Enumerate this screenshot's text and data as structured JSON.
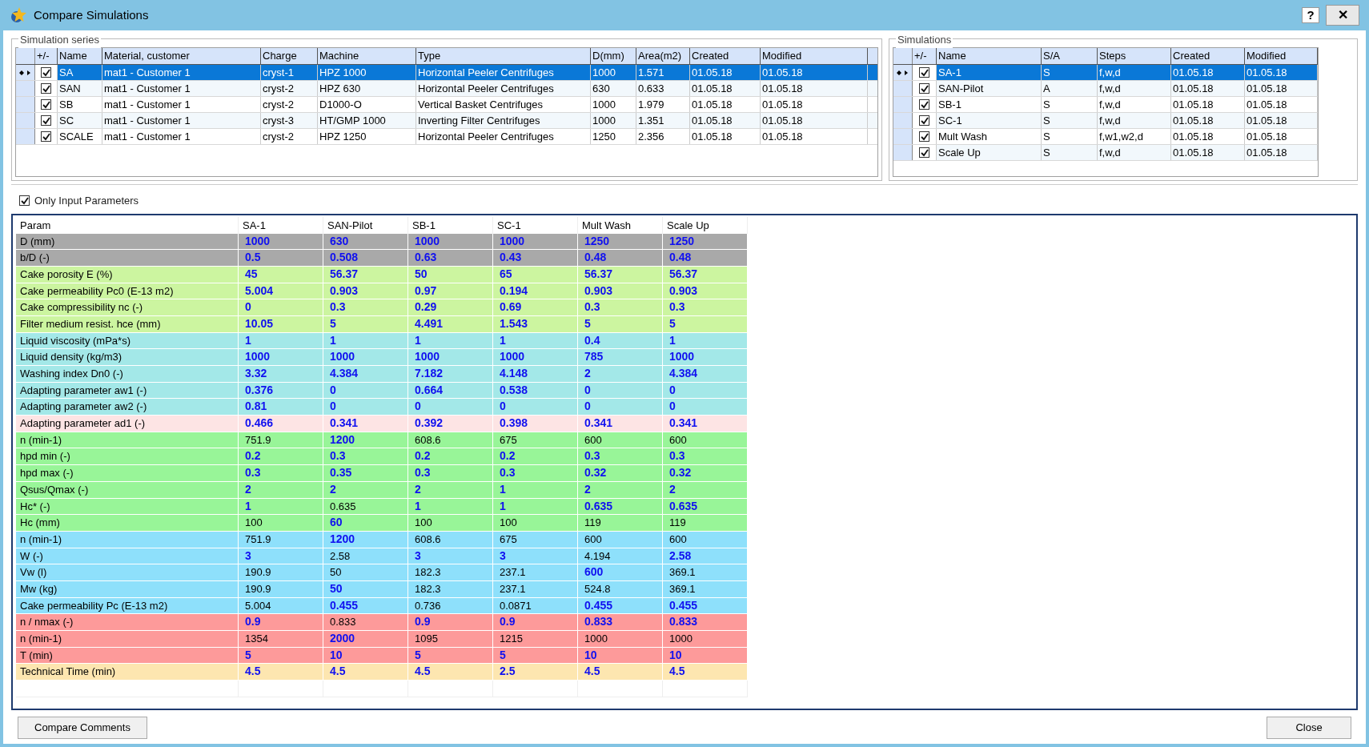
{
  "window": {
    "title": "Compare Simulations",
    "help": "?",
    "close": "✕"
  },
  "simulation_series": {
    "title": "Simulation series",
    "check_column": "+/-",
    "columns": [
      "Name",
      "Material, customer",
      "Charge",
      "Machine",
      "Type",
      "D(mm)",
      "Area(m2)",
      "Created",
      "Modified"
    ],
    "rows": [
      {
        "selected": true,
        "checked": true,
        "cells": [
          "SA",
          "mat1 - Customer 1",
          "cryst-1",
          "HPZ 1000",
          "Horizontal Peeler Centrifuges",
          "1000",
          "1.571",
          "01.05.18",
          "01.05.18"
        ]
      },
      {
        "selected": false,
        "checked": true,
        "cells": [
          "SAN",
          "mat1 - Customer 1",
          "cryst-2",
          "HPZ 630",
          "Horizontal Peeler Centrifuges",
          "630",
          "0.633",
          "01.05.18",
          "01.05.18"
        ]
      },
      {
        "selected": false,
        "checked": true,
        "cells": [
          "SB",
          "mat1 - Customer 1",
          "cryst-2",
          "D1000-O",
          "Vertical Basket Centrifuges",
          "1000",
          "1.979",
          "01.05.18",
          "01.05.18"
        ]
      },
      {
        "selected": false,
        "checked": true,
        "cells": [
          "SC",
          "mat1 - Customer 1",
          "cryst-3",
          "HT/GMP 1000",
          "Inverting Filter Centrifuges",
          "1000",
          "1.351",
          "01.05.18",
          "01.05.18"
        ]
      },
      {
        "selected": false,
        "checked": true,
        "cells": [
          "SCALE",
          "mat1 - Customer 1",
          "cryst-2",
          "HPZ 1250",
          "Horizontal Peeler Centrifuges",
          "1250",
          "2.356",
          "01.05.18",
          "01.05.18"
        ]
      }
    ]
  },
  "simulations": {
    "title": "Simulations",
    "check_column": "+/-",
    "columns": [
      "Name",
      "S/A",
      "Steps",
      "Created",
      "Modified"
    ],
    "rows": [
      {
        "selected": true,
        "checked": true,
        "cells": [
          "SA-1",
          "S",
          "f,w,d",
          "01.05.18",
          "01.05.18"
        ]
      },
      {
        "selected": false,
        "checked": true,
        "cells": [
          "SAN-Pilot",
          "A",
          "f,w,d",
          "01.05.18",
          "01.05.18"
        ]
      },
      {
        "selected": false,
        "checked": true,
        "cells": [
          "SB-1",
          "S",
          "f,w,d",
          "01.05.18",
          "01.05.18"
        ]
      },
      {
        "selected": false,
        "checked": true,
        "cells": [
          "SC-1",
          "S",
          "f,w,d",
          "01.05.18",
          "01.05.18"
        ]
      },
      {
        "selected": false,
        "checked": true,
        "cells": [
          "Mult Wash",
          "S",
          "f,w1,w2,d",
          "01.05.18",
          "01.05.18"
        ]
      },
      {
        "selected": false,
        "checked": true,
        "cells": [
          "Scale Up",
          "S",
          "f,w,d",
          "01.05.18",
          "01.05.18"
        ]
      }
    ]
  },
  "only_input_parameters": {
    "label": "Only Input Parameters",
    "checked": true
  },
  "comparison": {
    "columns": [
      "Param",
      "SA-1",
      "SAN-Pilot",
      "SB-1",
      "SC-1",
      "Mult Wash",
      "Scale Up"
    ],
    "rows": [
      {
        "param": "D (mm)",
        "color": "#a9a9a9",
        "values": [
          {
            "text": "1000",
            "bold": true
          },
          {
            "text": "630",
            "bold": true
          },
          {
            "text": "1000",
            "bold": true
          },
          {
            "text": "1000",
            "bold": true
          },
          {
            "text": "1250",
            "bold": true
          },
          {
            "text": "1250",
            "bold": true
          }
        ]
      },
      {
        "param": "b/D (-)",
        "color": "#a9a9a9",
        "values": [
          {
            "text": "0.5",
            "bold": true
          },
          {
            "text": "0.508",
            "bold": true
          },
          {
            "text": "0.63",
            "bold": true
          },
          {
            "text": "0.43",
            "bold": true
          },
          {
            "text": "0.48",
            "bold": true
          },
          {
            "text": "0.48",
            "bold": true
          }
        ]
      },
      {
        "param": "Cake porosity E (%)",
        "color": "#ccf5a0",
        "values": [
          {
            "text": "45",
            "bold": true
          },
          {
            "text": "56.37",
            "bold": true
          },
          {
            "text": "50",
            "bold": true
          },
          {
            "text": "65",
            "bold": true
          },
          {
            "text": "56.37",
            "bold": true
          },
          {
            "text": "56.37",
            "bold": true
          }
        ]
      },
      {
        "param": "Cake permeability Pc0 (E-13 m2)",
        "color": "#ccf5a0",
        "values": [
          {
            "text": "5.004",
            "bold": true
          },
          {
            "text": "0.903",
            "bold": true
          },
          {
            "text": "0.97",
            "bold": true
          },
          {
            "text": "0.194",
            "bold": true
          },
          {
            "text": "0.903",
            "bold": true
          },
          {
            "text": "0.903",
            "bold": true
          }
        ]
      },
      {
        "param": "Cake compressibility nc (-)",
        "color": "#ccf5a0",
        "values": [
          {
            "text": "0",
            "bold": true
          },
          {
            "text": "0.3",
            "bold": true
          },
          {
            "text": "0.29",
            "bold": true
          },
          {
            "text": "0.69",
            "bold": true
          },
          {
            "text": "0.3",
            "bold": true
          },
          {
            "text": "0.3",
            "bold": true
          }
        ]
      },
      {
        "param": "Filter medium resist. hce (mm)",
        "color": "#ccf5a0",
        "values": [
          {
            "text": "10.05",
            "bold": true
          },
          {
            "text": "5",
            "bold": true
          },
          {
            "text": "4.491",
            "bold": true
          },
          {
            "text": "1.543",
            "bold": true
          },
          {
            "text": "5",
            "bold": true
          },
          {
            "text": "5",
            "bold": true
          }
        ]
      },
      {
        "param": "Liquid viscosity (mPa*s)",
        "color": "#a3e8e8",
        "values": [
          {
            "text": "1",
            "bold": true
          },
          {
            "text": "1",
            "bold": true
          },
          {
            "text": "1",
            "bold": true
          },
          {
            "text": "1",
            "bold": true
          },
          {
            "text": "0.4",
            "bold": true
          },
          {
            "text": "1",
            "bold": true
          }
        ]
      },
      {
        "param": "Liquid density (kg/m3)",
        "color": "#a3e8e8",
        "values": [
          {
            "text": "1000",
            "bold": true
          },
          {
            "text": "1000",
            "bold": true
          },
          {
            "text": "1000",
            "bold": true
          },
          {
            "text": "1000",
            "bold": true
          },
          {
            "text": "785",
            "bold": true
          },
          {
            "text": "1000",
            "bold": true
          }
        ]
      },
      {
        "param": "Washing index Dn0 (-)",
        "color": "#a3e8e8",
        "values": [
          {
            "text": "3.32",
            "bold": true
          },
          {
            "text": "4.384",
            "bold": true
          },
          {
            "text": "7.182",
            "bold": true
          },
          {
            "text": "4.148",
            "bold": true
          },
          {
            "text": "2",
            "bold": true
          },
          {
            "text": "4.384",
            "bold": true
          }
        ]
      },
      {
        "param": "Adapting parameter aw1 (-)",
        "color": "#a3e8e8",
        "values": [
          {
            "text": "0.376",
            "bold": true
          },
          {
            "text": "0",
            "bold": true
          },
          {
            "text": "0.664",
            "bold": true
          },
          {
            "text": "0.538",
            "bold": true
          },
          {
            "text": "0",
            "bold": true
          },
          {
            "text": "0",
            "bold": true
          }
        ]
      },
      {
        "param": "Adapting parameter aw2 (-)",
        "color": "#a3e8e8",
        "values": [
          {
            "text": "0.81",
            "bold": true
          },
          {
            "text": "0",
            "bold": true
          },
          {
            "text": "0",
            "bold": true
          },
          {
            "text": "0",
            "bold": true
          },
          {
            "text": "0",
            "bold": true
          },
          {
            "text": "0",
            "bold": true
          }
        ]
      },
      {
        "param": "Adapting parameter ad1 (-)",
        "color": "#fde4e4",
        "values": [
          {
            "text": "0.466",
            "bold": true
          },
          {
            "text": "0.341",
            "bold": true
          },
          {
            "text": "0.392",
            "bold": true
          },
          {
            "text": "0.398",
            "bold": true
          },
          {
            "text": "0.341",
            "bold": true
          },
          {
            "text": "0.341",
            "bold": true
          }
        ]
      },
      {
        "param": "n (min-1)",
        "color": "#98f598",
        "values": [
          {
            "text": "751.9",
            "bold": false
          },
          {
            "text": "1200",
            "bold": true
          },
          {
            "text": "608.6",
            "bold": false
          },
          {
            "text": "675",
            "bold": false
          },
          {
            "text": "600",
            "bold": false
          },
          {
            "text": "600",
            "bold": false
          }
        ]
      },
      {
        "param": "hpd min (-)",
        "color": "#98f598",
        "values": [
          {
            "text": "0.2",
            "bold": true
          },
          {
            "text": "0.3",
            "bold": true
          },
          {
            "text": "0.2",
            "bold": true
          },
          {
            "text": "0.2",
            "bold": true
          },
          {
            "text": "0.3",
            "bold": true
          },
          {
            "text": "0.3",
            "bold": true
          }
        ]
      },
      {
        "param": "hpd max (-)",
        "color": "#98f598",
        "values": [
          {
            "text": "0.3",
            "bold": true
          },
          {
            "text": "0.35",
            "bold": true
          },
          {
            "text": "0.3",
            "bold": true
          },
          {
            "text": "0.3",
            "bold": true
          },
          {
            "text": "0.32",
            "bold": true
          },
          {
            "text": "0.32",
            "bold": true
          }
        ]
      },
      {
        "param": "Qsus/Qmax (-)",
        "color": "#98f598",
        "values": [
          {
            "text": "2",
            "bold": true
          },
          {
            "text": "2",
            "bold": true
          },
          {
            "text": "2",
            "bold": true
          },
          {
            "text": "1",
            "bold": true
          },
          {
            "text": "2",
            "bold": true
          },
          {
            "text": "2",
            "bold": true
          }
        ]
      },
      {
        "param": "Hc* (-)",
        "color": "#98f598",
        "values": [
          {
            "text": "1",
            "bold": true
          },
          {
            "text": "0.635",
            "bold": false
          },
          {
            "text": "1",
            "bold": true
          },
          {
            "text": "1",
            "bold": true
          },
          {
            "text": "0.635",
            "bold": true
          },
          {
            "text": "0.635",
            "bold": true
          }
        ]
      },
      {
        "param": "Hc (mm)",
        "color": "#98f598",
        "values": [
          {
            "text": "100",
            "bold": false
          },
          {
            "text": "60",
            "bold": true
          },
          {
            "text": "100",
            "bold": false
          },
          {
            "text": "100",
            "bold": false
          },
          {
            "text": "119",
            "bold": false
          },
          {
            "text": "119",
            "bold": false
          }
        ]
      },
      {
        "param": "n (min-1)",
        "color": "#8ee0fb",
        "values": [
          {
            "text": "751.9",
            "bold": false
          },
          {
            "text": "1200",
            "bold": true
          },
          {
            "text": "608.6",
            "bold": false
          },
          {
            "text": "675",
            "bold": false
          },
          {
            "text": "600",
            "bold": false
          },
          {
            "text": "600",
            "bold": false
          }
        ]
      },
      {
        "param": "W (-)",
        "color": "#8ee0fb",
        "values": [
          {
            "text": "3",
            "bold": true
          },
          {
            "text": "2.58",
            "bold": false
          },
          {
            "text": "3",
            "bold": true
          },
          {
            "text": "3",
            "bold": true
          },
          {
            "text": "4.194",
            "bold": false
          },
          {
            "text": "2.58",
            "bold": true
          }
        ]
      },
      {
        "param": "Vw (l)",
        "color": "#8ee0fb",
        "values": [
          {
            "text": "190.9",
            "bold": false
          },
          {
            "text": "50",
            "bold": false
          },
          {
            "text": "182.3",
            "bold": false
          },
          {
            "text": "237.1",
            "bold": false
          },
          {
            "text": "600",
            "bold": true
          },
          {
            "text": "369.1",
            "bold": false
          }
        ]
      },
      {
        "param": "Mw (kg)",
        "color": "#8ee0fb",
        "values": [
          {
            "text": "190.9",
            "bold": false
          },
          {
            "text": "50",
            "bold": true
          },
          {
            "text": "182.3",
            "bold": false
          },
          {
            "text": "237.1",
            "bold": false
          },
          {
            "text": "524.8",
            "bold": false
          },
          {
            "text": "369.1",
            "bold": false
          }
        ]
      },
      {
        "param": "Cake permeability Pc (E-13 m2)",
        "color": "#8ee0fb",
        "values": [
          {
            "text": "5.004",
            "bold": false
          },
          {
            "text": "0.455",
            "bold": true
          },
          {
            "text": "0.736",
            "bold": false
          },
          {
            "text": "0.0871",
            "bold": false
          },
          {
            "text": "0.455",
            "bold": true
          },
          {
            "text": "0.455",
            "bold": true
          }
        ]
      },
      {
        "param": "n / nmax (-)",
        "color": "#fd9a9a",
        "values": [
          {
            "text": "0.9",
            "bold": true
          },
          {
            "text": "0.833",
            "bold": false
          },
          {
            "text": "0.9",
            "bold": true
          },
          {
            "text": "0.9",
            "bold": true
          },
          {
            "text": "0.833",
            "bold": true
          },
          {
            "text": "0.833",
            "bold": true
          }
        ]
      },
      {
        "param": "n (min-1)",
        "color": "#fd9a9a",
        "values": [
          {
            "text": "1354",
            "bold": false
          },
          {
            "text": "2000",
            "bold": true
          },
          {
            "text": "1095",
            "bold": false
          },
          {
            "text": "1215",
            "bold": false
          },
          {
            "text": "1000",
            "bold": false
          },
          {
            "text": "1000",
            "bold": false
          }
        ]
      },
      {
        "param": "T (min)",
        "color": "#fd9a9a",
        "values": [
          {
            "text": "5",
            "bold": true
          },
          {
            "text": "10",
            "bold": true
          },
          {
            "text": "5",
            "bold": true
          },
          {
            "text": "5",
            "bold": true
          },
          {
            "text": "10",
            "bold": true
          },
          {
            "text": "10",
            "bold": true
          }
        ]
      },
      {
        "param": "Technical Time (min)",
        "color": "#fde6b0",
        "values": [
          {
            "text": "4.5",
            "bold": true
          },
          {
            "text": "4.5",
            "bold": true
          },
          {
            "text": "4.5",
            "bold": true
          },
          {
            "text": "2.5",
            "bold": true
          },
          {
            "text": "4.5",
            "bold": true
          },
          {
            "text": "4.5",
            "bold": true
          }
        ]
      }
    ]
  },
  "buttons": {
    "compare_comments": "Compare Comments",
    "close": "Close"
  }
}
